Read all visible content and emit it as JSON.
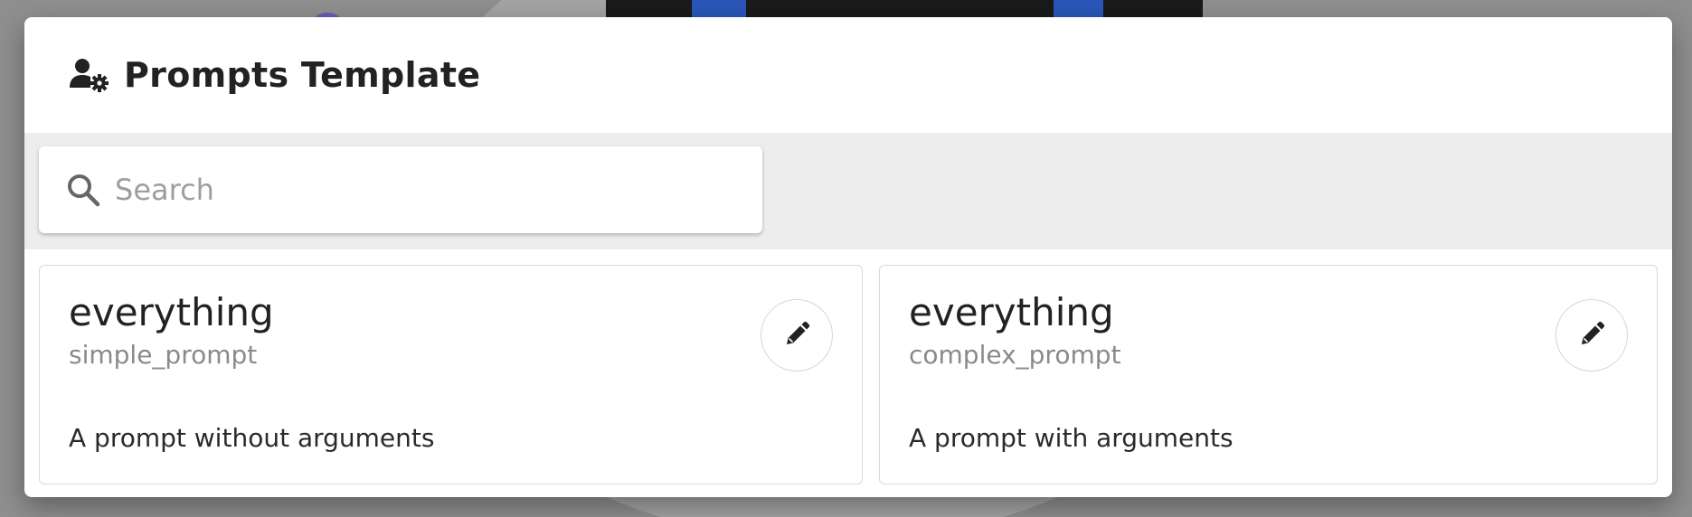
{
  "dialog": {
    "title": "Prompts Template",
    "header_icon": "user-gear-icon"
  },
  "search": {
    "placeholder": "Search",
    "value": "",
    "icon": "search-icon"
  },
  "prompts": [
    {
      "server": "everything",
      "name": "simple_prompt",
      "description": "A prompt without arguments",
      "action_icon": "pencil-icon"
    },
    {
      "server": "everything",
      "name": "complex_prompt",
      "description": "A prompt with arguments",
      "action_icon": "pencil-icon"
    }
  ],
  "colors": {
    "backdrop": "#8f8f8f",
    "surface": "#ffffff",
    "search_band": "#ededed",
    "text_primary": "#222222",
    "text_secondary": "#8a8a8a",
    "border": "#d9d9d9"
  }
}
